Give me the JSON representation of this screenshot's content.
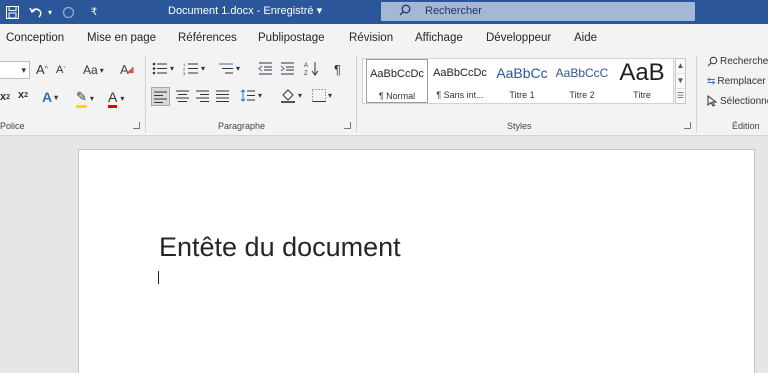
{
  "titlebar": {
    "document_title": "Document 1.docx  -  Enregistré ▾",
    "search_label": "Rechercher",
    "save_icon": "save-icon",
    "undo_icon": "undo-icon",
    "redo_icon": "redo-icon",
    "customize_icon": "customize-quick-access-icon",
    "accent_color": "#2b579a"
  },
  "tabs": [
    "Conception",
    "Mise en page",
    "Références",
    "Publipostage",
    "Révision",
    "Affichage",
    "Développeur",
    "Aide"
  ],
  "ribbon": {
    "groups": {
      "police": "Police",
      "paragraphe": "Paragraphe",
      "styles": "Styles",
      "edition": "Édition"
    },
    "font": {
      "grow": "A",
      "shrink": "A",
      "case": "Aa",
      "clear": "A",
      "subscript": "x",
      "superscript": "x",
      "effects": "A",
      "highlight": "✎",
      "color": "A"
    },
    "paragraph": {
      "show_marks": "¶"
    },
    "styles": [
      {
        "sample": "AaBbCcDc",
        "name": "¶ Normal"
      },
      {
        "sample": "AaBbCcDc",
        "name": "¶ Sans int..."
      },
      {
        "sample": "AaBbCc",
        "name": "Titre 1"
      },
      {
        "sample": "AaBbCcC",
        "name": "Titre 2"
      },
      {
        "sample": "AaB",
        "name": "Titre"
      }
    ],
    "editing": {
      "find": "Rechercher",
      "replace": "Remplacer",
      "select": "Sélectionner"
    }
  },
  "document": {
    "heading": "Entête du document"
  }
}
